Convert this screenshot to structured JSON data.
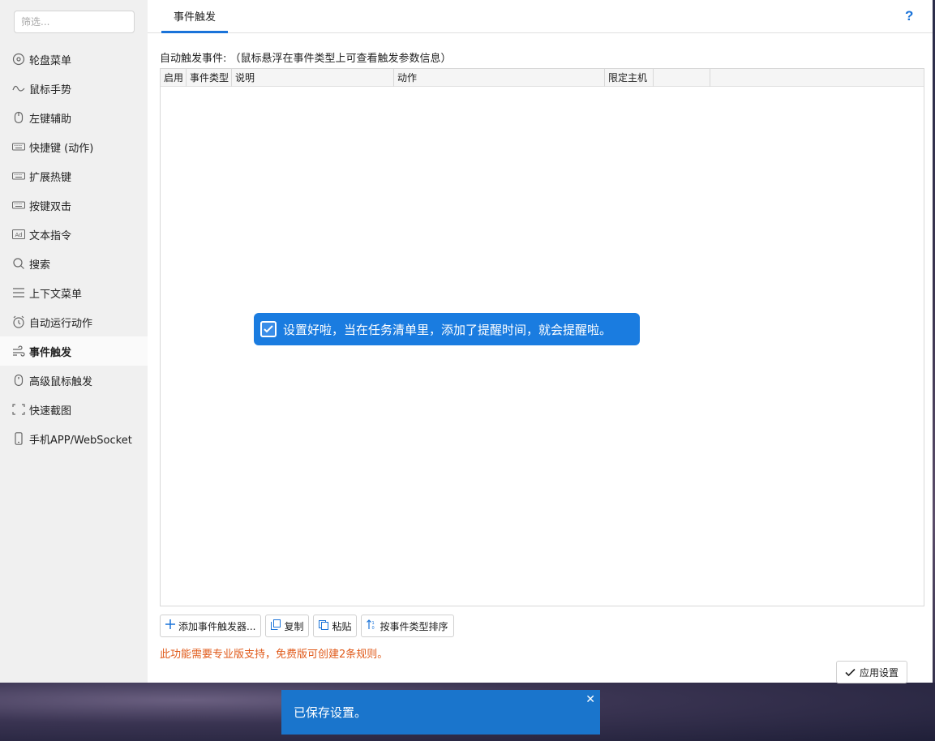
{
  "sidebar": {
    "filter_placeholder": "筛选...",
    "items": [
      {
        "label": "轮盘菜单",
        "icon": "wheel-icon"
      },
      {
        "label": "鼠标手势",
        "icon": "gesture-icon"
      },
      {
        "label": "左键辅助",
        "icon": "mouse-icon"
      },
      {
        "label": "快捷键 (动作)",
        "icon": "keyboard-icon"
      },
      {
        "label": "扩展热键",
        "icon": "keyboard-icon"
      },
      {
        "label": "按键双击",
        "icon": "keyboard-icon"
      },
      {
        "label": "文本指令",
        "icon": "ad-icon"
      },
      {
        "label": "搜索",
        "icon": "search-icon"
      },
      {
        "label": "上下文菜单",
        "icon": "menu-icon"
      },
      {
        "label": "自动运行动作",
        "icon": "clock-icon"
      },
      {
        "label": "事件触发",
        "icon": "wind-icon"
      },
      {
        "label": "高级鼠标触发",
        "icon": "mouse-icon"
      },
      {
        "label": "快速截图",
        "icon": "crop-icon"
      },
      {
        "label": "手机APP/WebSocket",
        "icon": "phone-icon"
      }
    ]
  },
  "header": {
    "tab": "事件触发",
    "help": "?"
  },
  "main": {
    "description": "自动触发事件: （鼠标悬浮在事件类型上可查看触发参数信息）",
    "columns": [
      "启用",
      "事件类型",
      "说明",
      "动作",
      "限定主机",
      "",
      ""
    ],
    "toast": "设置好啦，当在任务清单里，添加了提醒时间，就会提醒啦。",
    "buttons": {
      "add": "添加事件触发器...",
      "copy": "复制",
      "paste": "粘贴",
      "sort": "按事件类型排序"
    },
    "warning": "此功能需要专业版支持，免费版可创建2条规则。",
    "apply": "应用设置"
  },
  "notification": {
    "text": "已保存设置。",
    "close": "✕"
  },
  "colors": {
    "accent": "#1a73d9",
    "toast_bg": "#1a7ce0",
    "warning": "#e05a1a",
    "notify_bg": "#1a75cc"
  }
}
